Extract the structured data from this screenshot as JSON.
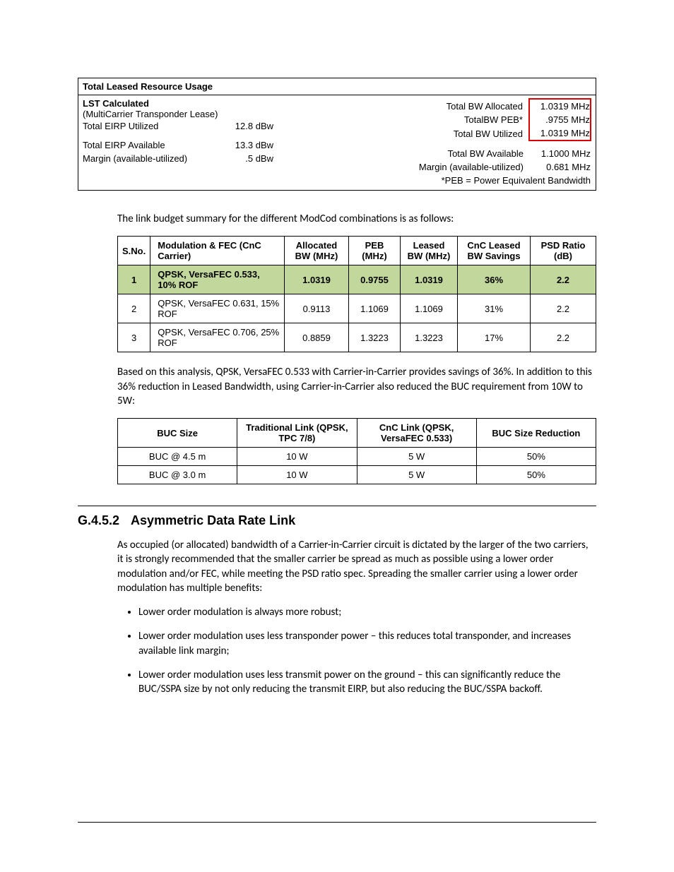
{
  "resource": {
    "title": "Total Leased Resource Usage",
    "lst_header": "LST Calculated",
    "lst_sub": "(MultiCarrier Transponder Lease)",
    "left_rows": [
      {
        "label": "Total EIRP Utilized",
        "value": "12.8 dBw"
      },
      {
        "label": "Total EIRP Available",
        "value": "13.3 dBw"
      },
      {
        "label": "Margin (available-utilized)",
        "value": ".5 dBw"
      }
    ],
    "right_rows": [
      {
        "label": "Total BW Allocated",
        "value": "1.0319 MHz",
        "hl": true
      },
      {
        "label": "TotalBW PEB*",
        "value": ".9755 MHz",
        "hl": true
      },
      {
        "label": "Total BW Utilized",
        "value": "1.0319 MHz",
        "hl": true
      },
      {
        "label": "Total BW Available",
        "value": "1.1000 MHz",
        "hl": false
      },
      {
        "label": "Margin (available-utilized)",
        "value": "0.681 MHz",
        "hl": false
      }
    ],
    "footnote": "*PEB = Power Equivalent Bandwidth"
  },
  "para_intro": "The link budget summary for the different ModCod combinations is as follows:",
  "table1": {
    "headers": [
      "S.No.",
      "Modulation & FEC (CnC Carrier)",
      "Allocated BW (MHz)",
      "PEB (MHz)",
      "Leased BW (MHz)",
      "CnC Leased BW Savings",
      "PSD Ratio (dB)"
    ],
    "rows": [
      {
        "sno": "1",
        "mod": "QPSK, VersaFEC 0.533, 10% ROF",
        "abw": "1.0319",
        "peb": "0.9755",
        "lbw": "1.0319",
        "sav": "36%",
        "psd": "2.2",
        "hl": true
      },
      {
        "sno": "2",
        "mod": "QPSK, VersaFEC 0.631, 15% ROF",
        "abw": "0.9113",
        "peb": "1.1069",
        "lbw": "1.1069",
        "sav": "31%",
        "psd": "2.2",
        "hl": false
      },
      {
        "sno": "3",
        "mod": "QPSK, VersaFEC 0.706, 25% ROF",
        "abw": "0.8859",
        "peb": "1.3223",
        "lbw": "1.3223",
        "sav": "17%",
        "psd": "2.2",
        "hl": false
      }
    ]
  },
  "para_analysis": "Based on this analysis, QPSK, VersaFEC 0.533 with Carrier-in-Carrier provides savings of 36%. In addition to this 36% reduction in Leased Bandwidth, using Carrier-in-Carrier also reduced the BUC requirement from 10W to 5W:",
  "table2": {
    "headers": [
      "BUC Size",
      "Traditional Link (QPSK, TPC 7/8)",
      "CnC Link (QPSK, VersaFEC 0.533)",
      "BUC Size Reduction"
    ],
    "rows": [
      {
        "size": "BUC @ 4.5 m",
        "trad": "10 W",
        "cnc": "5 W",
        "red": "50%"
      },
      {
        "size": "BUC @ 3.0 m",
        "trad": "10 W",
        "cnc": "5 W",
        "red": "50%"
      }
    ]
  },
  "section": {
    "num": "G.4.5.2",
    "title": "Asymmetric Data Rate Link",
    "para": "As occupied (or allocated) bandwidth of a Carrier-in-Carrier circuit is dictated by the larger of the two carriers, it is strongly recommended that the smaller carrier be spread as much as possible using a lower order modulation and/or FEC, while meeting the PSD ratio spec. Spreading the smaller carrier using a lower order modulation has multiple benefits:",
    "bullets": [
      "Lower order modulation is always more robust;",
      "Lower order modulation uses less transponder power – this reduces total transponder, and increases available link margin;",
      "Lower order modulation uses less transmit power on the ground – this can significantly reduce the BUC/SSPA size by not only reducing the transmit EIRP, but also reducing the BUC/SSPA backoff."
    ]
  }
}
